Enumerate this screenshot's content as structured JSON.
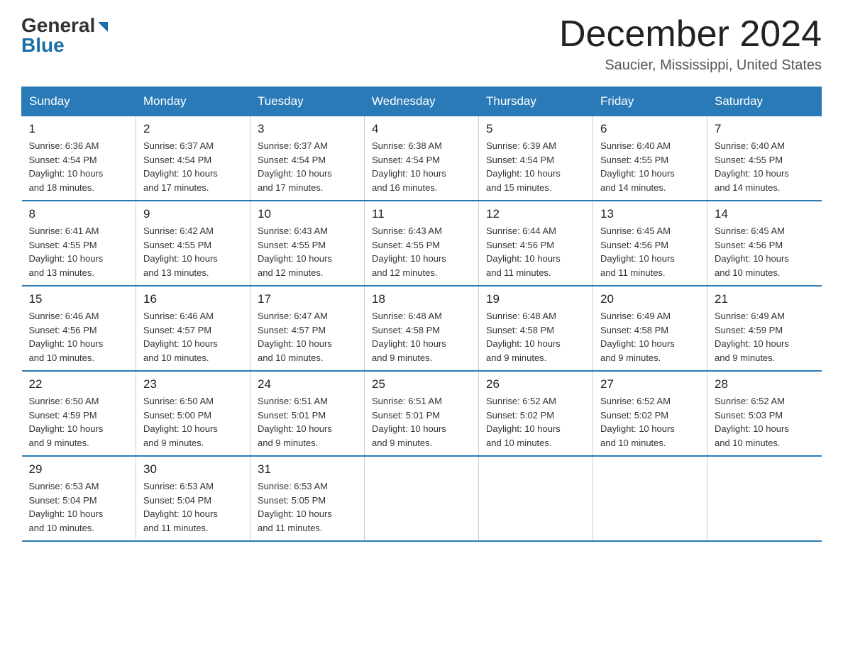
{
  "logo": {
    "general": "General",
    "blue": "Blue"
  },
  "header": {
    "month_title": "December 2024",
    "location": "Saucier, Mississippi, United States"
  },
  "weekdays": [
    "Sunday",
    "Monday",
    "Tuesday",
    "Wednesday",
    "Thursday",
    "Friday",
    "Saturday"
  ],
  "weeks": [
    [
      {
        "num": "1",
        "info": "Sunrise: 6:36 AM\nSunset: 4:54 PM\nDaylight: 10 hours\nand 18 minutes."
      },
      {
        "num": "2",
        "info": "Sunrise: 6:37 AM\nSunset: 4:54 PM\nDaylight: 10 hours\nand 17 minutes."
      },
      {
        "num": "3",
        "info": "Sunrise: 6:37 AM\nSunset: 4:54 PM\nDaylight: 10 hours\nand 17 minutes."
      },
      {
        "num": "4",
        "info": "Sunrise: 6:38 AM\nSunset: 4:54 PM\nDaylight: 10 hours\nand 16 minutes."
      },
      {
        "num": "5",
        "info": "Sunrise: 6:39 AM\nSunset: 4:54 PM\nDaylight: 10 hours\nand 15 minutes."
      },
      {
        "num": "6",
        "info": "Sunrise: 6:40 AM\nSunset: 4:55 PM\nDaylight: 10 hours\nand 14 minutes."
      },
      {
        "num": "7",
        "info": "Sunrise: 6:40 AM\nSunset: 4:55 PM\nDaylight: 10 hours\nand 14 minutes."
      }
    ],
    [
      {
        "num": "8",
        "info": "Sunrise: 6:41 AM\nSunset: 4:55 PM\nDaylight: 10 hours\nand 13 minutes."
      },
      {
        "num": "9",
        "info": "Sunrise: 6:42 AM\nSunset: 4:55 PM\nDaylight: 10 hours\nand 13 minutes."
      },
      {
        "num": "10",
        "info": "Sunrise: 6:43 AM\nSunset: 4:55 PM\nDaylight: 10 hours\nand 12 minutes."
      },
      {
        "num": "11",
        "info": "Sunrise: 6:43 AM\nSunset: 4:55 PM\nDaylight: 10 hours\nand 12 minutes."
      },
      {
        "num": "12",
        "info": "Sunrise: 6:44 AM\nSunset: 4:56 PM\nDaylight: 10 hours\nand 11 minutes."
      },
      {
        "num": "13",
        "info": "Sunrise: 6:45 AM\nSunset: 4:56 PM\nDaylight: 10 hours\nand 11 minutes."
      },
      {
        "num": "14",
        "info": "Sunrise: 6:45 AM\nSunset: 4:56 PM\nDaylight: 10 hours\nand 10 minutes."
      }
    ],
    [
      {
        "num": "15",
        "info": "Sunrise: 6:46 AM\nSunset: 4:56 PM\nDaylight: 10 hours\nand 10 minutes."
      },
      {
        "num": "16",
        "info": "Sunrise: 6:46 AM\nSunset: 4:57 PM\nDaylight: 10 hours\nand 10 minutes."
      },
      {
        "num": "17",
        "info": "Sunrise: 6:47 AM\nSunset: 4:57 PM\nDaylight: 10 hours\nand 10 minutes."
      },
      {
        "num": "18",
        "info": "Sunrise: 6:48 AM\nSunset: 4:58 PM\nDaylight: 10 hours\nand 9 minutes."
      },
      {
        "num": "19",
        "info": "Sunrise: 6:48 AM\nSunset: 4:58 PM\nDaylight: 10 hours\nand 9 minutes."
      },
      {
        "num": "20",
        "info": "Sunrise: 6:49 AM\nSunset: 4:58 PM\nDaylight: 10 hours\nand 9 minutes."
      },
      {
        "num": "21",
        "info": "Sunrise: 6:49 AM\nSunset: 4:59 PM\nDaylight: 10 hours\nand 9 minutes."
      }
    ],
    [
      {
        "num": "22",
        "info": "Sunrise: 6:50 AM\nSunset: 4:59 PM\nDaylight: 10 hours\nand 9 minutes."
      },
      {
        "num": "23",
        "info": "Sunrise: 6:50 AM\nSunset: 5:00 PM\nDaylight: 10 hours\nand 9 minutes."
      },
      {
        "num": "24",
        "info": "Sunrise: 6:51 AM\nSunset: 5:01 PM\nDaylight: 10 hours\nand 9 minutes."
      },
      {
        "num": "25",
        "info": "Sunrise: 6:51 AM\nSunset: 5:01 PM\nDaylight: 10 hours\nand 9 minutes."
      },
      {
        "num": "26",
        "info": "Sunrise: 6:52 AM\nSunset: 5:02 PM\nDaylight: 10 hours\nand 10 minutes."
      },
      {
        "num": "27",
        "info": "Sunrise: 6:52 AM\nSunset: 5:02 PM\nDaylight: 10 hours\nand 10 minutes."
      },
      {
        "num": "28",
        "info": "Sunrise: 6:52 AM\nSunset: 5:03 PM\nDaylight: 10 hours\nand 10 minutes."
      }
    ],
    [
      {
        "num": "29",
        "info": "Sunrise: 6:53 AM\nSunset: 5:04 PM\nDaylight: 10 hours\nand 10 minutes."
      },
      {
        "num": "30",
        "info": "Sunrise: 6:53 AM\nSunset: 5:04 PM\nDaylight: 10 hours\nand 11 minutes."
      },
      {
        "num": "31",
        "info": "Sunrise: 6:53 AM\nSunset: 5:05 PM\nDaylight: 10 hours\nand 11 minutes."
      },
      null,
      null,
      null,
      null
    ]
  ]
}
